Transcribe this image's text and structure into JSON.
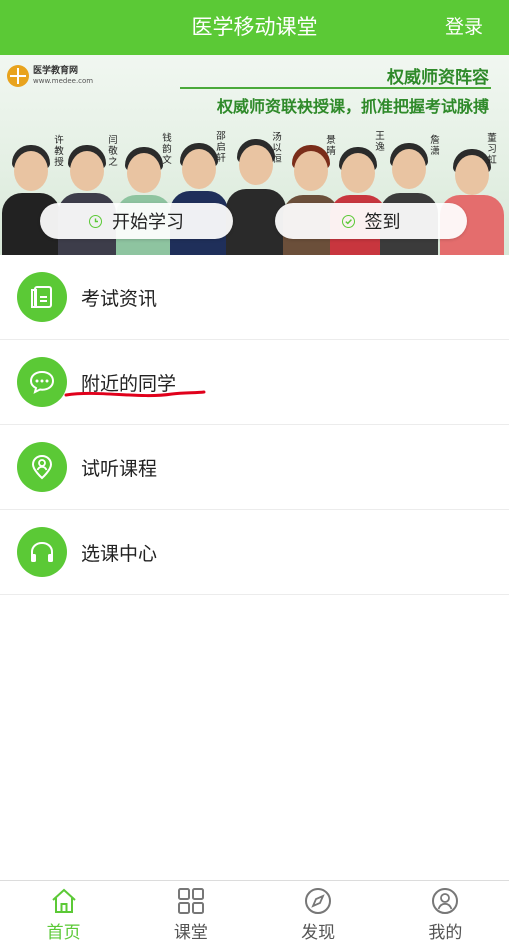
{
  "header": {
    "title": "医学移动课堂",
    "login_label": "登录"
  },
  "banner": {
    "brand_name": "医学教育网",
    "brand_url": "www.medee.com",
    "slogan_1": "权威师资阵容",
    "slogan_2": "权威师资联袂授课，抓准把握考试脉搏",
    "teachers": [
      "许教授",
      "闫敬之",
      "钱韵文",
      "邵启轩",
      "汤以恒",
      "景晴",
      "王逸",
      "詹潇",
      "董习虹"
    ],
    "start_study_label": "开始学习",
    "checkin_label": "签到"
  },
  "menu": {
    "items": [
      {
        "label": "考试资讯",
        "icon": "document-icon"
      },
      {
        "label": "附近的同学",
        "icon": "chat-bubble-icon"
      },
      {
        "label": "试听课程",
        "icon": "location-user-icon"
      },
      {
        "label": "选课中心",
        "icon": "headphones-icon"
      }
    ]
  },
  "tabbar": {
    "items": [
      {
        "label": "首页",
        "icon": "home-icon",
        "active": true
      },
      {
        "label": "课堂",
        "icon": "grid-icon",
        "active": false
      },
      {
        "label": "发现",
        "icon": "compass-icon",
        "active": false
      },
      {
        "label": "我的",
        "icon": "user-icon",
        "active": false
      }
    ]
  },
  "colors": {
    "accent": "#5bc936",
    "annotation_red": "#e0001b"
  }
}
